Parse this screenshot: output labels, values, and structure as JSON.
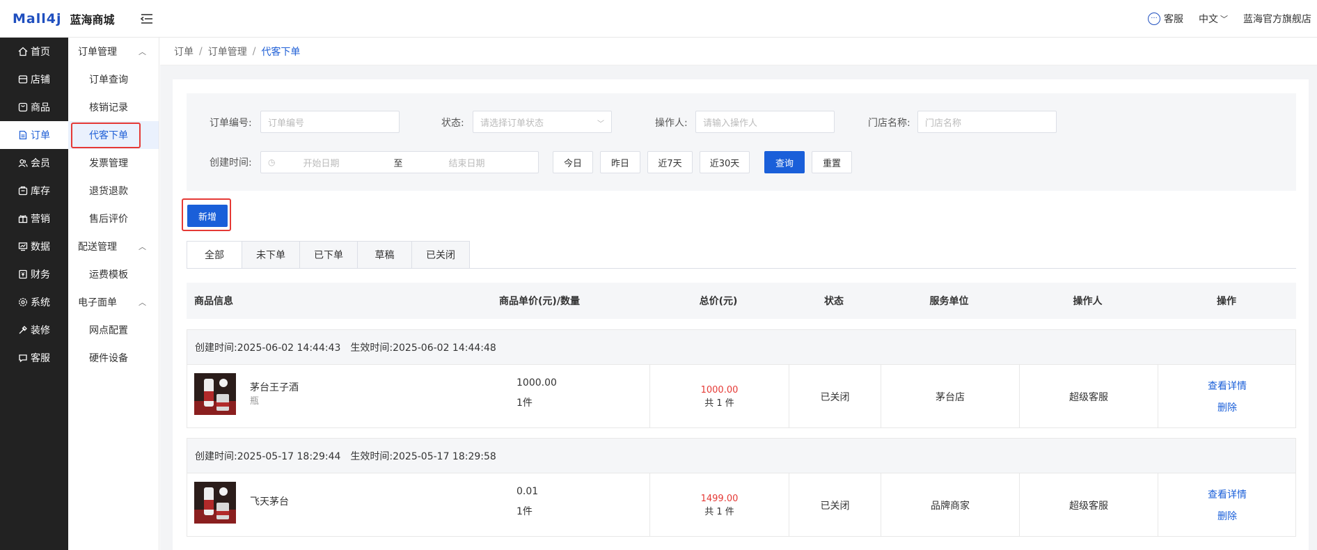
{
  "header": {
    "logo_mark": "Mall4j",
    "logo_text": "蓝海商城",
    "service_label": "客服",
    "language_label": "中文",
    "store_label": "蓝海官方旗舰店"
  },
  "nav_primary": [
    {
      "label": "首页",
      "icon": "home-icon"
    },
    {
      "label": "店铺",
      "icon": "store-icon"
    },
    {
      "label": "商品",
      "icon": "goods-icon"
    },
    {
      "label": "订单",
      "icon": "order-icon",
      "active": true
    },
    {
      "label": "会员",
      "icon": "member-icon"
    },
    {
      "label": "库存",
      "icon": "stock-icon"
    },
    {
      "label": "营销",
      "icon": "gift-icon"
    },
    {
      "label": "数据",
      "icon": "chart-icon"
    },
    {
      "label": "财务",
      "icon": "finance-icon"
    },
    {
      "label": "系统",
      "icon": "settings-icon"
    },
    {
      "label": "装修",
      "icon": "decor-icon"
    },
    {
      "label": "客服",
      "icon": "chat-icon"
    }
  ],
  "nav_secondary": {
    "group1": "订单管理",
    "g1_items": [
      "订单查询",
      "核销记录",
      "代客下单",
      "发票管理",
      "退货退款",
      "售后评价"
    ],
    "group2": "配送管理",
    "g2_items": [
      "运费模板"
    ],
    "group3": "电子面单",
    "g3_items": [
      "网点配置",
      "硬件设备"
    ]
  },
  "breadcrumb": [
    "订单",
    "订单管理",
    "代客下单"
  ],
  "filters": {
    "order_no_label": "订单编号:",
    "order_no_placeholder": "订单编号",
    "status_label": "状态:",
    "status_placeholder": "请选择订单状态",
    "operator_label": "操作人:",
    "operator_placeholder": "请输入操作人",
    "store_label": "门店名称:",
    "store_placeholder": "门店名称",
    "created_label": "创建时间:",
    "start_placeholder": "开始日期",
    "range_sep": "至",
    "end_placeholder": "结束日期",
    "btn_today": "今日",
    "btn_yesterday": "昨日",
    "btn_7d": "近7天",
    "btn_30d": "近30天",
    "btn_query": "查询",
    "btn_reset": "重置"
  },
  "add_label": "新增",
  "tabs": [
    "全部",
    "未下单",
    "已下单",
    "草稿",
    "已关闭"
  ],
  "table_headers": [
    "商品信息",
    "商品单价(元)/数量",
    "总价(元)",
    "状态",
    "服务单位",
    "操作人",
    "操作"
  ],
  "orders": [
    {
      "created": "创建时间:2025-06-02 14:44:43",
      "effective": "生效时间:2025-06-02 14:44:48",
      "product_name": "茅台王子酒",
      "product_unit": "瓶",
      "unit_price": "1000.00",
      "quantity": "1件",
      "total": "1000.00",
      "total_count": "共 1 件",
      "status": "已关闭",
      "service_unit": "茅台店",
      "operator": "超级客服",
      "action_detail": "查看详情",
      "action_delete": "删除"
    },
    {
      "created": "创建时间:2025-05-17 18:29:44",
      "effective": "生效时间:2025-05-17 18:29:58",
      "product_name": "飞天茅台",
      "product_unit": "",
      "unit_price": "0.01",
      "quantity": "1件",
      "total": "1499.00",
      "total_count": "共 1 件",
      "status": "已关闭",
      "service_unit": "品牌商家",
      "operator": "超级客服",
      "action_detail": "查看详情",
      "action_delete": "删除"
    }
  ],
  "colors": {
    "primary": "#1a5fd9",
    "nav_bg": "#222222",
    "price_red": "#e53935",
    "highlight_red": "#e53935"
  }
}
